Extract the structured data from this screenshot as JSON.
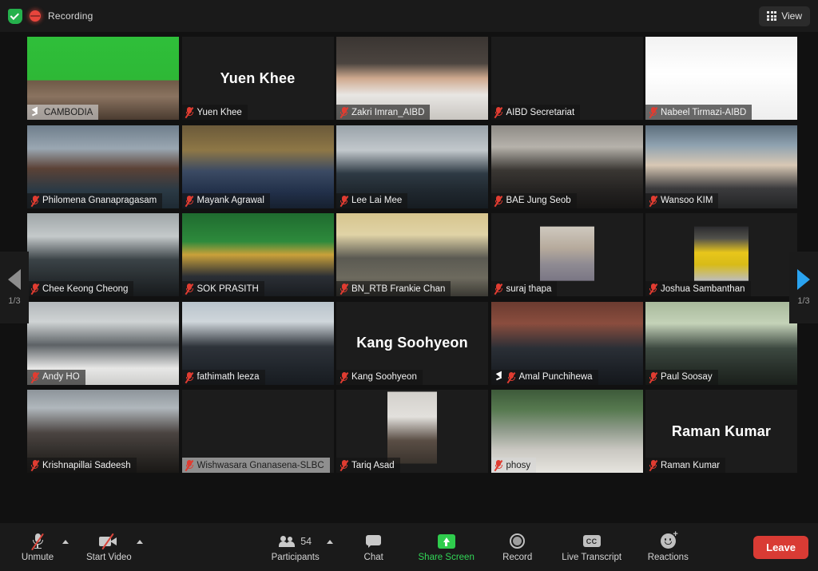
{
  "topbar": {
    "recording_label": "Recording",
    "shield_icon": "encryption-shield-icon",
    "record_dot_icon": "recording-indicator-icon",
    "view_label": "View",
    "view_icon": "grid-view-icon"
  },
  "gallery": {
    "page_prev_label": "1/3",
    "page_next_label": "1/3",
    "prev_icon": "chevron-left-icon",
    "next_icon": "chevron-right-icon",
    "rows": 5,
    "cols": 5,
    "tiles": [
      {
        "name": "CAMBODIA",
        "kind": "video",
        "active": true,
        "muted": false,
        "pinned": true,
        "bg": "cambodia",
        "label_light": true
      },
      {
        "name": "Yuen Khee",
        "kind": "name-only",
        "active": false,
        "muted": true,
        "pinned": false,
        "bg": "dark"
      },
      {
        "name": "Zakri Imran_AIBD",
        "kind": "video",
        "active": false,
        "muted": true,
        "pinned": false,
        "bg": "zakri"
      },
      {
        "name": "AIBD Secretariat",
        "kind": "video",
        "active": false,
        "muted": true,
        "pinned": false,
        "bg": "secretariat"
      },
      {
        "name": "Nabeel Tirmazi-AIBD",
        "kind": "video",
        "active": false,
        "muted": true,
        "pinned": false,
        "bg": "aibdlogo"
      },
      {
        "name": "Philomena Gnanapragasam",
        "kind": "video",
        "active": false,
        "muted": true,
        "pinned": false,
        "bg": "philomena"
      },
      {
        "name": "Mayank Agrawal",
        "kind": "video",
        "active": false,
        "muted": true,
        "pinned": false,
        "bg": "mayank"
      },
      {
        "name": "Lee Lai Mee",
        "kind": "video",
        "active": false,
        "muted": true,
        "pinned": false,
        "bg": "leelaimee"
      },
      {
        "name": "BAE Jung Seob",
        "kind": "video",
        "active": false,
        "muted": true,
        "pinned": false,
        "bg": "bae"
      },
      {
        "name": "Wansoo KIM",
        "kind": "video",
        "active": false,
        "muted": true,
        "pinned": false,
        "bg": "wansoo"
      },
      {
        "name": "Chee Keong Cheong",
        "kind": "video",
        "active": false,
        "muted": true,
        "pinned": false,
        "bg": "cheekeong"
      },
      {
        "name": "SOK PRASITH",
        "kind": "video",
        "active": false,
        "muted": true,
        "pinned": false,
        "bg": "sokprasith"
      },
      {
        "name": "BN_RTB Frankie Chan",
        "kind": "video",
        "active": false,
        "muted": true,
        "pinned": false,
        "bg": "frankie"
      },
      {
        "name": "suraj thapa",
        "kind": "avatar",
        "active": false,
        "muted": true,
        "pinned": false,
        "bg": "suraj"
      },
      {
        "name": "Joshua Sambanthan",
        "kind": "avatar",
        "active": false,
        "muted": true,
        "pinned": false,
        "bg": "joshua"
      },
      {
        "name": "Andy HO",
        "kind": "video",
        "active": false,
        "muted": true,
        "pinned": false,
        "bg": "andyho"
      },
      {
        "name": "fathimath leeza",
        "kind": "video",
        "active": false,
        "muted": true,
        "pinned": false,
        "bg": "fathimath"
      },
      {
        "name": "Kang Soohyeon",
        "kind": "name-only",
        "active": false,
        "muted": true,
        "pinned": false,
        "bg": "dark"
      },
      {
        "name": "Amal Punchihewa",
        "kind": "video",
        "active": false,
        "muted": true,
        "pinned": true,
        "bg": "amal"
      },
      {
        "name": "Paul Soosay",
        "kind": "video",
        "active": false,
        "muted": true,
        "pinned": false,
        "bg": "paul"
      },
      {
        "name": "Krishnapillai Sadeesh",
        "kind": "video",
        "active": false,
        "muted": true,
        "pinned": false,
        "bg": "krishna"
      },
      {
        "name": "Wishwasara Gnanasena-SLBC",
        "kind": "video",
        "active": false,
        "muted": true,
        "pinned": false,
        "bg": "wishwasara",
        "label_light": true
      },
      {
        "name": "Tariq Asad",
        "kind": "avatar-tall",
        "active": false,
        "muted": true,
        "pinned": false,
        "bg": "tariq"
      },
      {
        "name": "phosy",
        "kind": "video",
        "active": false,
        "muted": true,
        "pinned": false,
        "bg": "phosy",
        "label_light": true
      },
      {
        "name": "Raman Kumar",
        "kind": "name-only",
        "active": false,
        "muted": true,
        "pinned": false,
        "bg": "dark"
      }
    ]
  },
  "toolbar": {
    "unmute_label": "Unmute",
    "unmute_icon": "microphone-muted-icon",
    "unmute_caret_icon": "chevron-up-icon",
    "start_video_label": "Start Video",
    "start_video_icon": "camera-off-icon",
    "start_video_caret_icon": "chevron-up-icon",
    "participants_label": "Participants",
    "participants_icon": "people-icon",
    "participants_count": "54",
    "participants_caret_icon": "chevron-up-icon",
    "chat_label": "Chat",
    "chat_icon": "chat-bubble-icon",
    "share_screen_label": "Share Screen",
    "share_screen_icon": "share-screen-icon",
    "record_label": "Record",
    "record_icon": "record-circle-icon",
    "live_transcript_label": "Live Transcript",
    "live_transcript_icon": "closed-caption-icon",
    "reactions_label": "Reactions",
    "reactions_icon": "smiley-reactions-icon",
    "leave_label": "Leave"
  },
  "colors": {
    "app_bg": "#111111",
    "bar_bg": "#1a1a1a",
    "active_speaker": "#c8e64a",
    "accent_green": "#32d657",
    "leave_red": "#d93b34",
    "next_arrow_blue": "#2aa3f0",
    "mute_red": "#e03c31"
  }
}
